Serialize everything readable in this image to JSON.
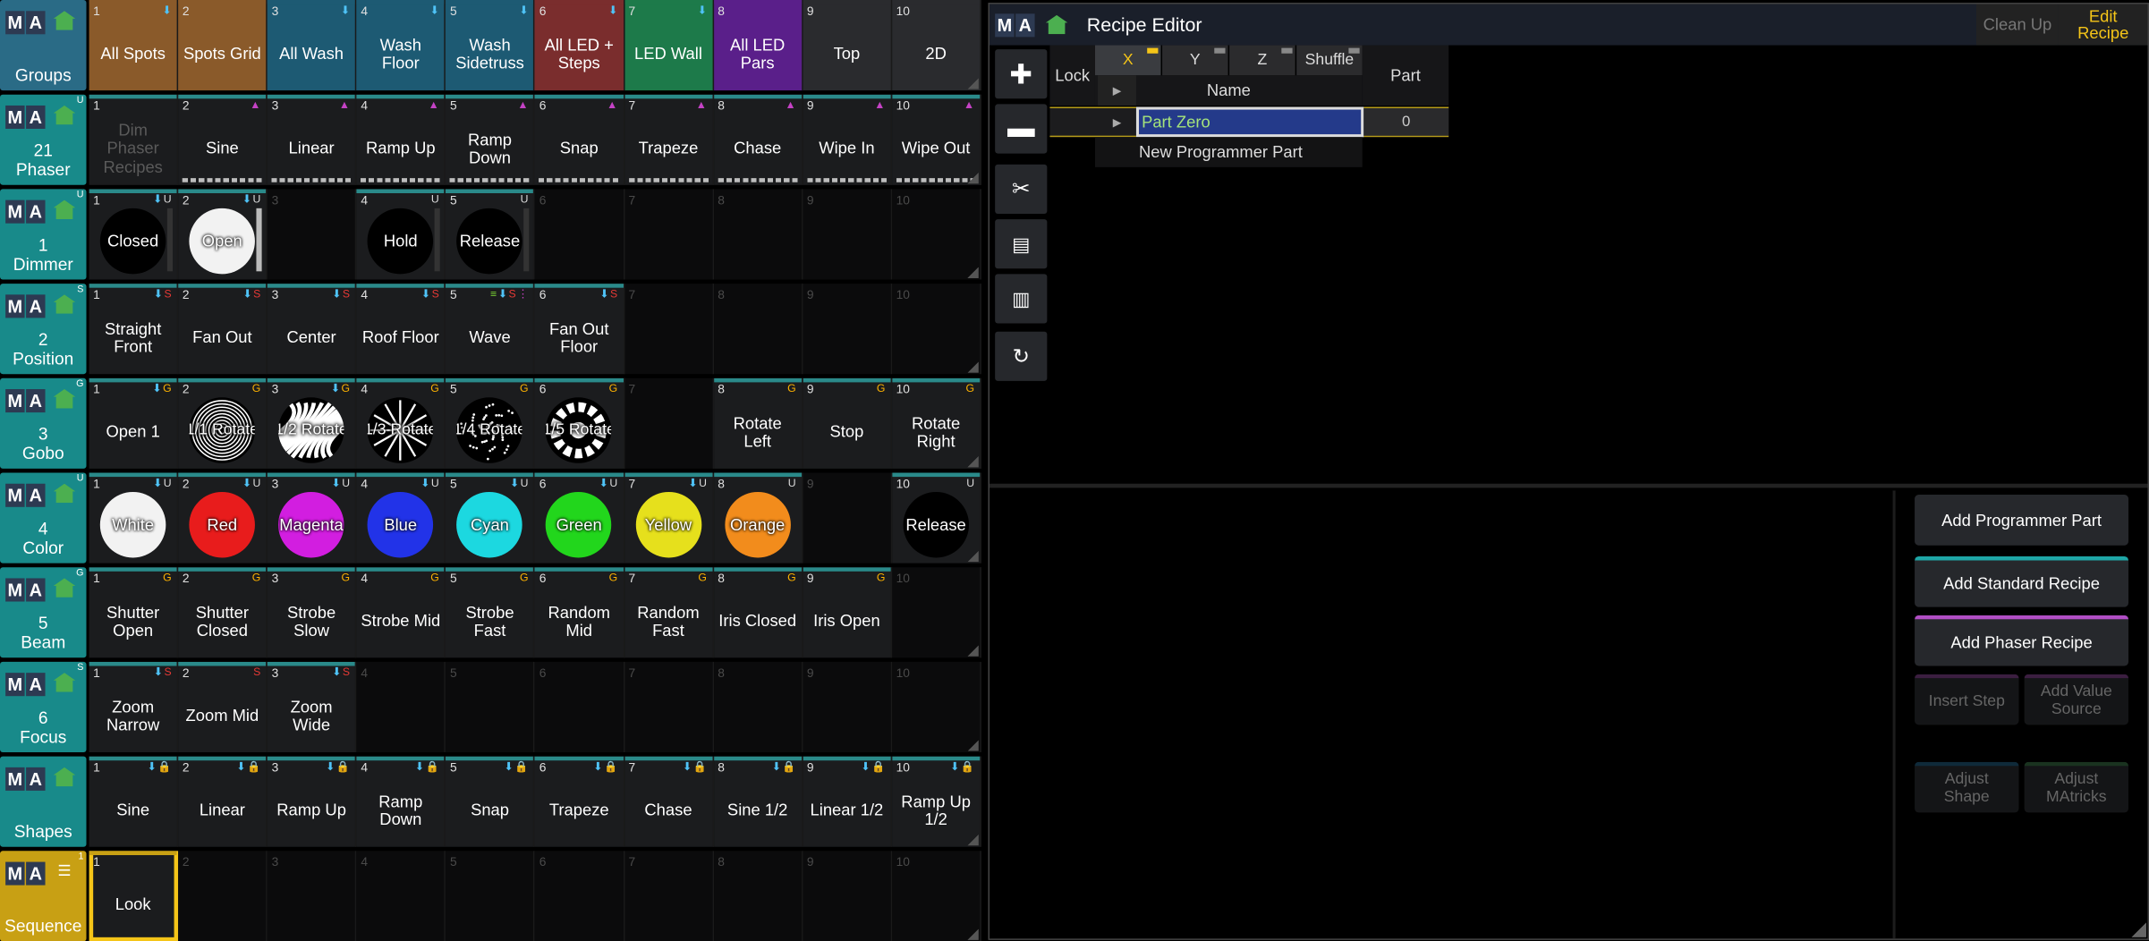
{
  "rows": [
    {
      "title": "Groups",
      "flag": "",
      "header_color": "#2a6b86",
      "icon": "home-icon",
      "cells": [
        {
          "n": "1",
          "label": "All Spots",
          "bg": "#8a5a2a",
          "ico": "⬇︎",
          "icon_names": [
            "store-icon"
          ]
        },
        {
          "n": "2",
          "label": "Spots Grid",
          "bg": "#8a5a2a",
          "ico": "",
          "icon_names": []
        },
        {
          "n": "3",
          "label": "All Wash",
          "bg": "#1d5a73",
          "ico": "⬇︎",
          "icon_names": [
            "store-icon"
          ]
        },
        {
          "n": "4",
          "label": "Wash Floor",
          "bg": "#1d5a73",
          "ico": "⬇︎",
          "icon_names": [
            "store-icon"
          ]
        },
        {
          "n": "5",
          "label": "Wash\nSidetruss",
          "bg": "#1d5a73",
          "ico": "⬇︎",
          "icon_names": [
            "store-icon"
          ]
        },
        {
          "n": "6",
          "label": "All LED +\nSteps",
          "bg": "#7a2d2d",
          "ico": "⬇︎",
          "icon_names": [
            "store-icon"
          ]
        },
        {
          "n": "7",
          "label": "LED Wall",
          "bg": "#1d7a4a",
          "ico": "⬇︎",
          "icon_names": [
            "store-icon"
          ]
        },
        {
          "n": "8",
          "label": "All LED\nPars",
          "bg": "#5a1f8a",
          "ico": "",
          "icon_names": []
        },
        {
          "n": "9",
          "label": "Top",
          "bg": "#2a2b2e",
          "ico": "",
          "icon_names": []
        },
        {
          "n": "10",
          "label": "2D",
          "bg": "#2a2b2e",
          "ico": "",
          "icon_names": []
        }
      ]
    },
    {
      "title": "21\nPhaser",
      "flag": "U",
      "header_color": "#188a8a",
      "icon": "home-icon",
      "cells": [
        {
          "n": "1",
          "label": "Dim\nPhaser\nRecipes",
          "dim": true,
          "ico": ""
        },
        {
          "n": "2",
          "label": "Sine",
          "prog": true,
          "ico": "ph"
        },
        {
          "n": "3",
          "label": "Linear",
          "prog": true,
          "ico": "ph"
        },
        {
          "n": "4",
          "label": "Ramp Up",
          "prog": true,
          "ico": "ph"
        },
        {
          "n": "5",
          "label": "Ramp\nDown",
          "prog": true,
          "ico": "ph"
        },
        {
          "n": "6",
          "label": "Snap",
          "prog": true,
          "ico": "ph"
        },
        {
          "n": "7",
          "label": "Trapeze",
          "prog": true,
          "ico": "ph"
        },
        {
          "n": "8",
          "label": "Chase",
          "prog": true,
          "ico": "ph"
        },
        {
          "n": "9",
          "label": "Wipe In",
          "prog": true,
          "ico": "ph"
        },
        {
          "n": "10",
          "label": "Wipe Out",
          "prog": true,
          "ico": "ph"
        }
      ]
    },
    {
      "title": "1\nDimmer",
      "flag": "U",
      "header_color": "#188a8a",
      "icon": "home-icon",
      "cells": [
        {
          "n": "1",
          "circle": "Closed",
          "color": "#000000",
          "ico": "u",
          "slider": 0.0
        },
        {
          "n": "2",
          "circle": "Open",
          "color": "#f2f2f2",
          "ico": "u",
          "slider": 1.0
        },
        {
          "n": "3",
          "empty": true
        },
        {
          "n": "4",
          "circle": "Hold",
          "color": "#000000",
          "ico": "uonly",
          "slider": 0.0
        },
        {
          "n": "5",
          "circle": "Release",
          "color": "#000000",
          "ico": "uonly",
          "slider": 0.0
        },
        {
          "n": "6",
          "empty": true
        },
        {
          "n": "7",
          "empty": true
        },
        {
          "n": "8",
          "empty": true
        },
        {
          "n": "9",
          "empty": true
        },
        {
          "n": "10",
          "empty": true
        }
      ]
    },
    {
      "title": "2\nPosition",
      "flag": "S",
      "header_color": "#188a8a",
      "icon": "home-icon",
      "cells": [
        {
          "n": "1",
          "label": "Straight\nFront",
          "ico": "s"
        },
        {
          "n": "2",
          "label": "Fan Out",
          "ico": "s"
        },
        {
          "n": "3",
          "label": "Center",
          "ico": "s"
        },
        {
          "n": "4",
          "label": "Roof Floor",
          "ico": "s"
        },
        {
          "n": "5",
          "label": "Wave",
          "ico": "sph"
        },
        {
          "n": "6",
          "label": "Fan Out\nFloor",
          "ico": "s"
        },
        {
          "n": "7",
          "empty": true
        },
        {
          "n": "8",
          "empty": true
        },
        {
          "n": "9",
          "empty": true
        },
        {
          "n": "10",
          "empty": true
        }
      ]
    },
    {
      "title": "3\nGobo",
      "flag": "G",
      "header_color": "#188a8a",
      "icon": "home-icon",
      "cells": [
        {
          "n": "1",
          "label": "Open 1",
          "ico": "g"
        },
        {
          "n": "2",
          "gobo": "1/1 Rotate",
          "pattern": "swirl",
          "ico": "gonly"
        },
        {
          "n": "3",
          "gobo": "1/2 Rotate",
          "pattern": "zebra",
          "ico": "g"
        },
        {
          "n": "4",
          "gobo": "1/3 Rotate",
          "pattern": "star",
          "ico": "gonly"
        },
        {
          "n": "5",
          "gobo": "1/4 Rotate",
          "pattern": "dots",
          "ico": "gonly"
        },
        {
          "n": "6",
          "gobo": "1/5 Rotate",
          "pattern": "ring",
          "ico": "gonly"
        },
        {
          "n": "7",
          "empty": true
        },
        {
          "n": "8",
          "label": "Rotate\nLeft",
          "ico": "gonly"
        },
        {
          "n": "9",
          "label": "Stop",
          "ico": "gonly"
        },
        {
          "n": "10",
          "label": "Rotate\nRight",
          "ico": "gonly"
        }
      ]
    },
    {
      "title": "4\nColor",
      "flag": "U",
      "header_color": "#188a8a",
      "icon": "home-icon",
      "cells": [
        {
          "n": "1",
          "circle": "White",
          "color": "#f2f2f2",
          "ico": "u"
        },
        {
          "n": "2",
          "circle": "Red",
          "color": "#e81c1c",
          "ico": "u"
        },
        {
          "n": "3",
          "circle": "Magenta",
          "color": "#d21ee0",
          "ico": "u"
        },
        {
          "n": "4",
          "circle": "Blue",
          "color": "#2233e8",
          "ico": "u"
        },
        {
          "n": "5",
          "circle": "Cyan",
          "color": "#1cd8e0",
          "ico": "u"
        },
        {
          "n": "6",
          "circle": "Green",
          "color": "#22d61c",
          "ico": "u"
        },
        {
          "n": "7",
          "circle": "Yellow",
          "color": "#e6e01c",
          "ico": "u"
        },
        {
          "n": "8",
          "circle": "Orange",
          "color": "#f28c1c",
          "ico": "uonly"
        },
        {
          "n": "9",
          "empty": true
        },
        {
          "n": "10",
          "circle": "Release",
          "color": "#000000",
          "ico": "uonly"
        }
      ]
    },
    {
      "title": "5\nBeam",
      "flag": "G",
      "header_color": "#188a8a",
      "icon": "home-icon",
      "cells": [
        {
          "n": "1",
          "label": "Shutter\nOpen",
          "ico": "gonly"
        },
        {
          "n": "2",
          "label": "Shutter\nClosed",
          "ico": "gonly"
        },
        {
          "n": "3",
          "label": "Strobe\nSlow",
          "ico": "gonly"
        },
        {
          "n": "4",
          "label": "Strobe Mid",
          "ico": "gonly"
        },
        {
          "n": "5",
          "label": "Strobe\nFast",
          "ico": "gonly"
        },
        {
          "n": "6",
          "label": "Random\nMid",
          "ico": "gonly"
        },
        {
          "n": "7",
          "label": "Random\nFast",
          "ico": "gonly"
        },
        {
          "n": "8",
          "label": "Iris Closed",
          "ico": "gonly"
        },
        {
          "n": "9",
          "label": "Iris Open",
          "ico": "gonly"
        },
        {
          "n": "10",
          "empty": true
        }
      ]
    },
    {
      "title": "6\nFocus",
      "flag": "S",
      "header_color": "#188a8a",
      "icon": "home-icon",
      "cells": [
        {
          "n": "1",
          "label": "Zoom\nNarrow",
          "ico": "s"
        },
        {
          "n": "2",
          "label": "Zoom Mid",
          "ico": "sonly"
        },
        {
          "n": "3",
          "label": "Zoom Wide",
          "ico": "s"
        },
        {
          "n": "4",
          "empty": true
        },
        {
          "n": "5",
          "empty": true
        },
        {
          "n": "6",
          "empty": true
        },
        {
          "n": "7",
          "empty": true
        },
        {
          "n": "8",
          "empty": true
        },
        {
          "n": "9",
          "empty": true
        },
        {
          "n": "10",
          "empty": true
        }
      ]
    },
    {
      "title": "Shapes",
      "flag": "",
      "header_color": "#188a8a",
      "icon": "home-icon",
      "cells": [
        {
          "n": "1",
          "label": "Sine",
          "ico": "lock"
        },
        {
          "n": "2",
          "label": "Linear",
          "ico": "lock"
        },
        {
          "n": "3",
          "label": "Ramp Up",
          "ico": "lock"
        },
        {
          "n": "4",
          "label": "Ramp\nDown",
          "ico": "lock"
        },
        {
          "n": "5",
          "label": "Snap",
          "ico": "lock"
        },
        {
          "n": "6",
          "label": "Trapeze",
          "ico": "lock"
        },
        {
          "n": "7",
          "label": "Chase",
          "ico": "lock"
        },
        {
          "n": "8",
          "label": "Sine 1/2",
          "ico": "lock"
        },
        {
          "n": "9",
          "label": "Linear 1/2",
          "ico": "lock"
        },
        {
          "n": "10",
          "label": "Ramp Up\n1/2",
          "ico": "lock"
        }
      ]
    },
    {
      "title": "Sequence",
      "flag": "1",
      "header_color": "#c8a014",
      "icon": "list-icon",
      "cells": [
        {
          "n": "1",
          "label": "Look",
          "selected": true
        },
        {
          "n": "2",
          "empty": true
        },
        {
          "n": "3",
          "empty": true
        },
        {
          "n": "4",
          "empty": true
        },
        {
          "n": "5",
          "empty": true
        },
        {
          "n": "6",
          "empty": true
        },
        {
          "n": "7",
          "empty": true
        },
        {
          "n": "8",
          "empty": true
        },
        {
          "n": "9",
          "empty": true
        },
        {
          "n": "10",
          "empty": true
        }
      ]
    }
  ],
  "editor": {
    "title": "Recipe Editor",
    "clean_up": "Clean Up",
    "edit_recipe": "Edit\nRecipe",
    "columns": {
      "lock": "Lock",
      "x": "X",
      "y": "Y",
      "z": "Z",
      "shuffle": "Shuffle",
      "part": "Part",
      "name": "Name"
    },
    "rows": [
      {
        "name": "Part Zero",
        "part": "0"
      }
    ],
    "new_row": "New Programmer Part",
    "tools": [
      "plus-icon",
      "minus-icon",
      "scissors-icon",
      "paste-icon",
      "insert-icon",
      "refresh-icon"
    ],
    "actions": {
      "add_programmer_part": "Add Programmer Part",
      "add_standard_recipe": "Add Standard Recipe",
      "add_phaser_recipe": "Add Phaser Recipe",
      "insert_step": "Insert Step",
      "add_value_source": "Add Value\nSource",
      "adjust_shape": "Adjust\nShape",
      "adjust_matricks": "Adjust\nMAtricks"
    }
  }
}
